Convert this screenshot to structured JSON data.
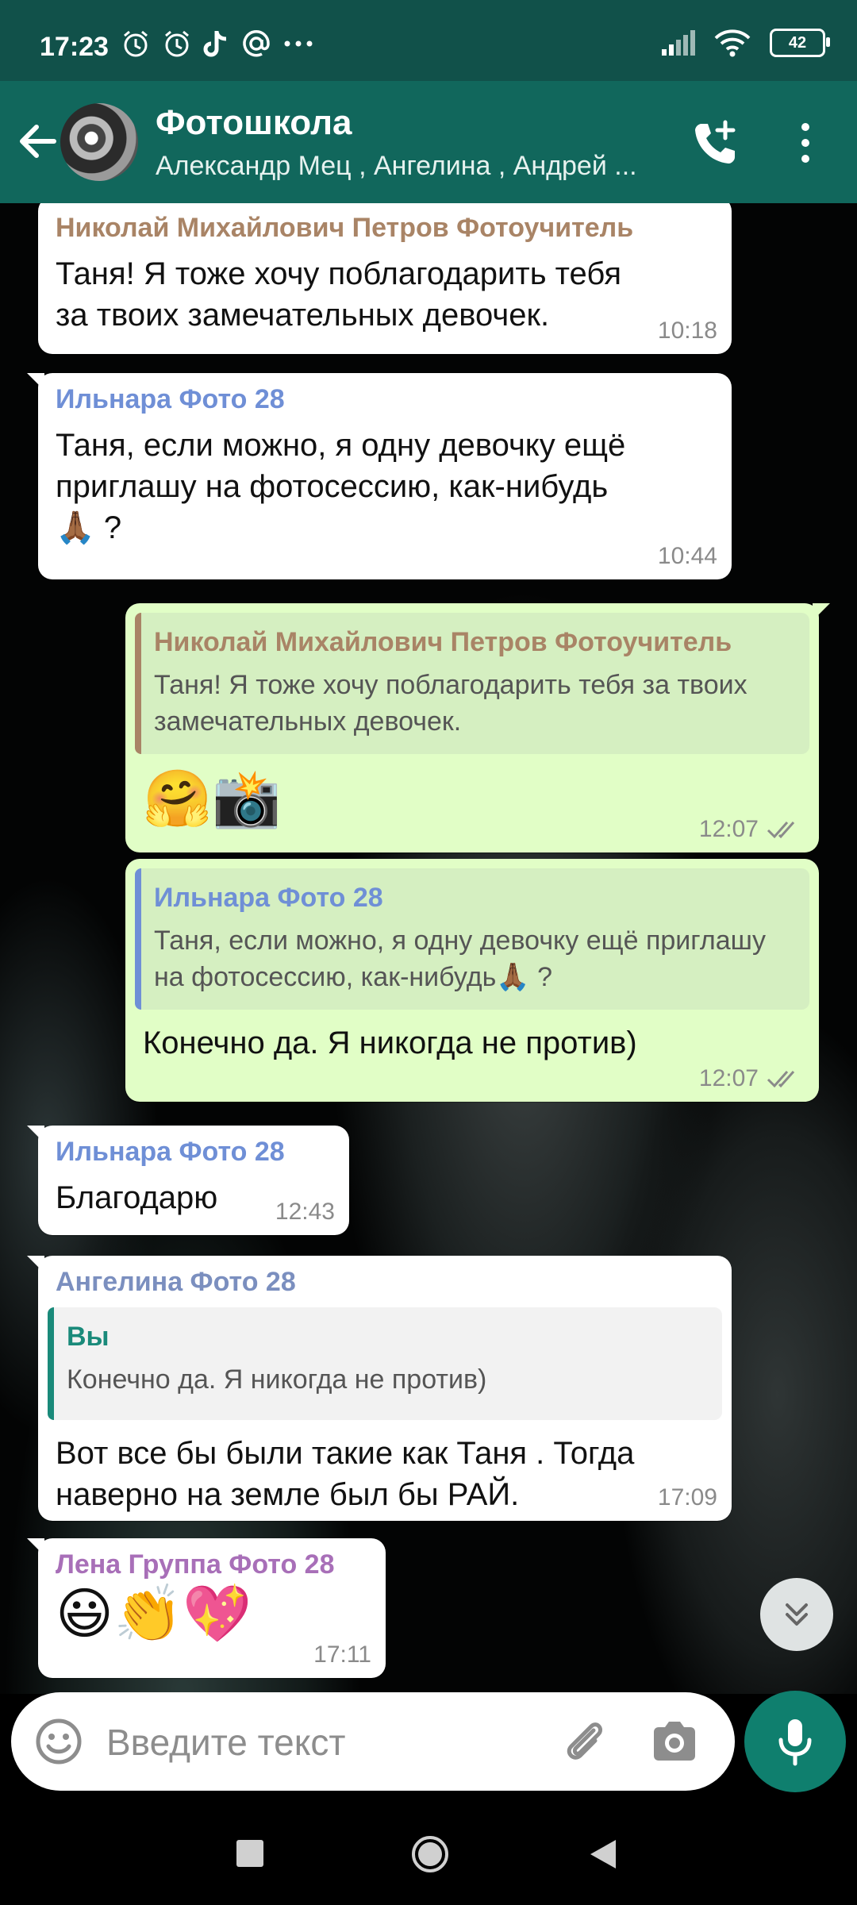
{
  "status_bar": {
    "time": "17:23",
    "battery": "42"
  },
  "header": {
    "title": "Фотошкола",
    "subtitle": "Александр Мец , Ангелина , Андрей ..."
  },
  "messages": [
    {
      "direction": "in",
      "sender": "Николай Михайлович Петров Фотоучитель",
      "sender_color": "#a98466",
      "text": "Таня! Я тоже хочу поблагодарить тебя за твоих замечательных девочек.",
      "time": "10:18"
    },
    {
      "direction": "in",
      "sender": "Ильнара Фото 28",
      "sender_color": "#6f8fd6",
      "text": "Таня, если можно, я одну девочку ещё приглашу на фотосессию, как-нибудь",
      "text_end": "🙏🏾 ?",
      "time": "10:44"
    },
    {
      "direction": "out",
      "quote_sender": "Николай Михайлович Петров Фотоучитель",
      "quote_color": "#a98466",
      "quote_text": "Таня! Я тоже хочу поблагодарить тебя за твоих замечательных девочек.",
      "text": "🤗📸",
      "time": "12:07"
    },
    {
      "direction": "out",
      "quote_sender": "Ильнара Фото 28",
      "quote_color": "#6f8fd6",
      "quote_text": "Таня, если можно, я одну девочку ещё приглашу на фотосессию, как-нибудь🙏🏾 ?",
      "text": "Конечно да. Я никогда не против)",
      "time": "12:07"
    },
    {
      "direction": "in",
      "sender": "Ильнара Фото 28",
      "sender_color": "#6f8fd6",
      "text": "Благодарю",
      "time": "12:43"
    },
    {
      "direction": "in",
      "sender": "Ангелина Фото 28",
      "sender_color": "#7b8fbf",
      "quote_sender": "Вы",
      "quote_color": "#1a8a7a",
      "quote_text": "Конечно да. Я никогда не против)",
      "text": "Вот все бы были такие как Таня . Тогда наверно на земле был бы РАЙ.",
      "time": "17:09"
    },
    {
      "direction": "in",
      "sender": "Лена Группа Фото 28",
      "sender_color": "#a86fb8",
      "text": "😃👏💖",
      "time": "17:11"
    }
  ],
  "composer": {
    "placeholder": "Введите текст"
  },
  "colors": {
    "header": "#11675c",
    "status_bar": "#11514a",
    "outgoing_bubble": "#e1fec6",
    "accent": "#0f7f6e",
    "tick": "#8a8a8a"
  },
  "icons": [
    "back-arrow-icon",
    "add-call-icon",
    "more-vert-icon",
    "emoji-icon",
    "attach-icon",
    "camera-icon",
    "mic-icon",
    "scroll-down-icon"
  ]
}
